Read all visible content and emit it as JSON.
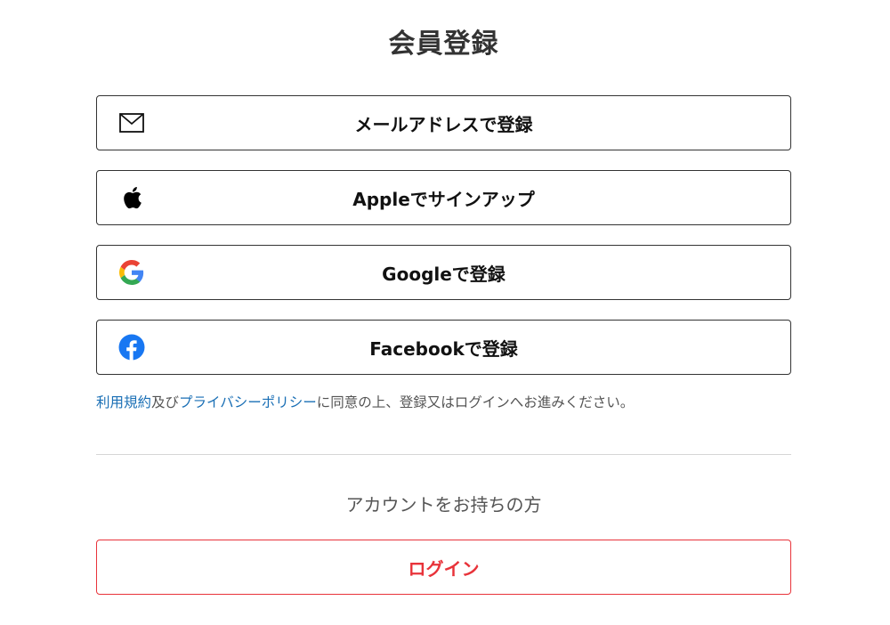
{
  "page": {
    "title": "会員登録"
  },
  "signup_options": [
    {
      "label": "メールアドレスで登録",
      "icon": "mail-icon"
    },
    {
      "label": "Appleでサインアップ",
      "icon": "apple-icon"
    },
    {
      "label": "Googleで登録",
      "icon": "google-icon"
    },
    {
      "label": "Facebookで登録",
      "icon": "facebook-icon"
    }
  ],
  "terms": {
    "terms_link": "利用規約",
    "and_text": "及び",
    "privacy_link": "プライバシーポリシー",
    "suffix_text": "に同意の上、登録又はログインへお進みください。"
  },
  "login_section": {
    "prompt": "アカウントをお持ちの方",
    "login_label": "ログイン"
  },
  "colors": {
    "link": "#1a6fb5",
    "login_accent": "#e8333a",
    "border": "#333333",
    "facebook_blue": "#1877f2"
  }
}
